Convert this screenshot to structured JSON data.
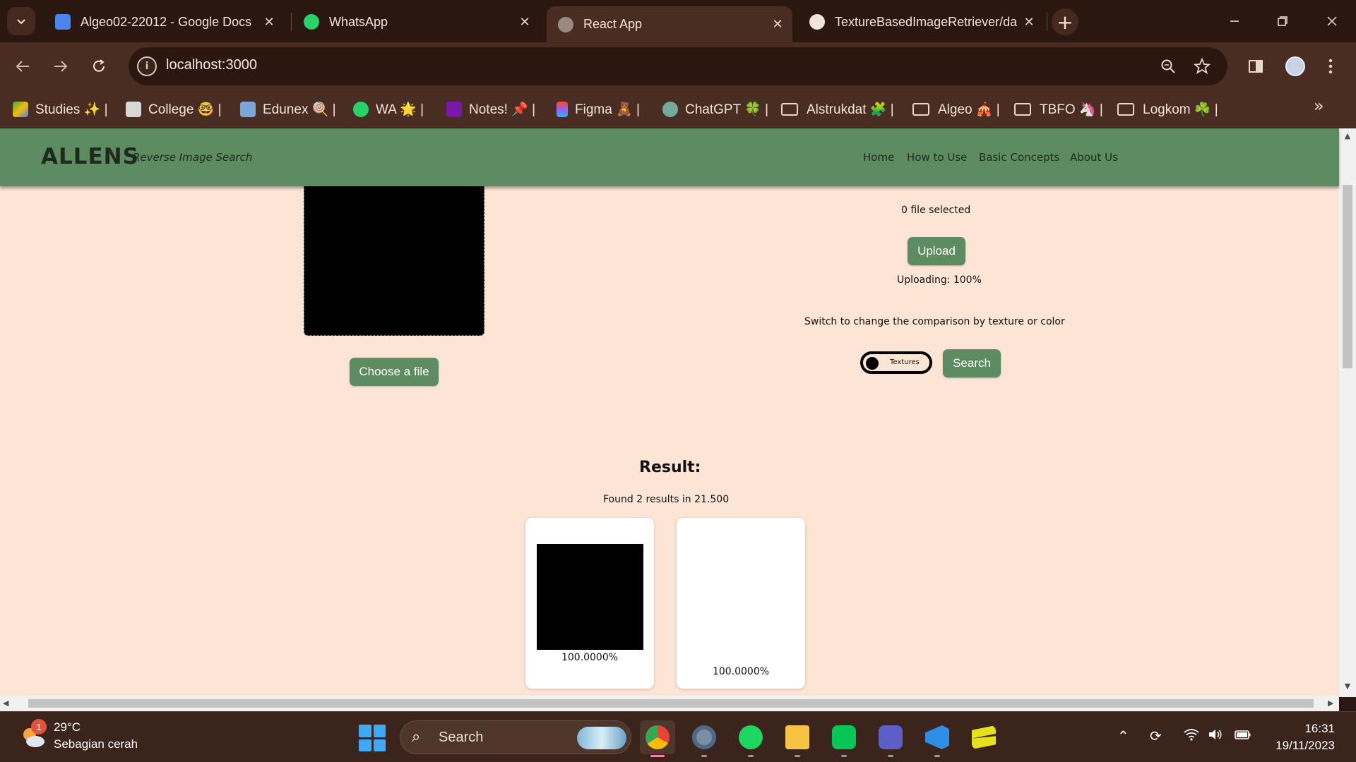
{
  "browser": {
    "tabs": [
      {
        "title": "Algeo02-22012 - Google Docs",
        "icon": "google-docs-icon",
        "active": false
      },
      {
        "title": "WhatsApp",
        "icon": "whatsapp-icon",
        "active": false
      },
      {
        "title": "React App",
        "icon": "globe-icon",
        "active": true
      },
      {
        "title": "TextureBasedImageRetriever/da",
        "icon": "github-icon",
        "active": false
      }
    ],
    "close_glyph": "✕",
    "new_tab_glyph": "+",
    "url": "localhost:3000",
    "bookmarks": [
      {
        "label": "Studies ✨ |",
        "icon": "google-drive-icon"
      },
      {
        "label": "College 🤓 |",
        "icon": "college-icon"
      },
      {
        "label": "Edunex 🍭 |",
        "icon": "edunex-icon"
      },
      {
        "label": "WA 🌟 |",
        "icon": "whatsapp-icon"
      },
      {
        "label": "Notes! 📌 |",
        "icon": "onenote-icon"
      },
      {
        "label": "Figma 🧸 |",
        "icon": "figma-icon"
      },
      {
        "label": "ChatGPT 🍀 |",
        "icon": "chatgpt-icon"
      },
      {
        "label": "Alstrukdat 🧩 |",
        "icon": "folder-icon"
      },
      {
        "label": "Algeo 🎪 |",
        "icon": "folder-icon"
      },
      {
        "label": "TBFO 🦄 |",
        "icon": "folder-icon"
      },
      {
        "label": "Logkom ☘️ |",
        "icon": "folder-icon"
      }
    ]
  },
  "app": {
    "brand": "ALLENS",
    "brand_subtitle": "Reverse Image Search",
    "nav": [
      "Home",
      "How to Use",
      "Basic Concepts",
      "About Us"
    ],
    "choose_file_label": "Choose a file",
    "files_selected": "0 file selected",
    "upload_label": "Upload",
    "upload_status": "Uploading: 100%",
    "switch_hint": "Switch to change the comparison by texture or color",
    "toggle_label": "Textures",
    "search_label": "Search",
    "result_title": "Result:",
    "result_summary": "Found 2 results in 21.500",
    "results": [
      {
        "score": "100.0000%",
        "image": "black"
      },
      {
        "score": "100.0000%",
        "image": "white"
      }
    ]
  },
  "taskbar": {
    "weather_badge": "1",
    "temperature": "29°C",
    "weather": "Sebagian cerah",
    "search_label": "Search",
    "time": "16:31",
    "date": "19/11/2023"
  },
  "colors": {
    "page_bg": "#fde5d5",
    "header_green": "#5e8c61",
    "browser_dark": "#2a1710",
    "browser_toolbar": "#4a2d22"
  }
}
